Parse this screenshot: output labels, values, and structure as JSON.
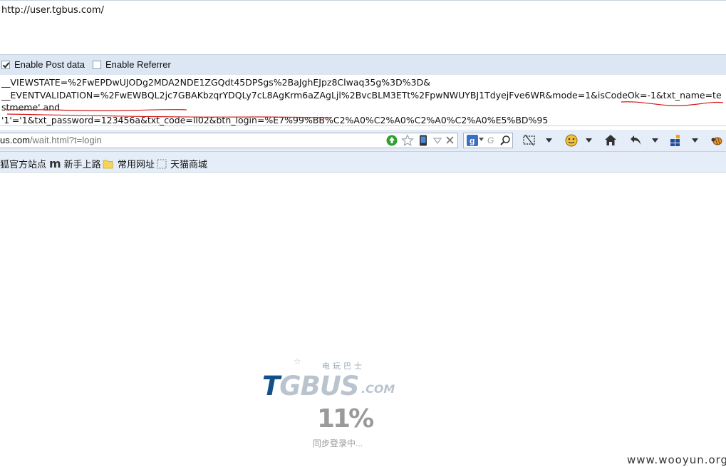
{
  "url_field": {
    "value": "http://user.tgbus.com/"
  },
  "options": {
    "enable_post_data": {
      "label": "Enable Post data",
      "checked": true
    },
    "enable_referrer": {
      "label": "Enable Referrer",
      "checked": false
    }
  },
  "post_data": {
    "line1": "__VIEWSTATE=%2FwEPDwUJODg2MDA2NDE1ZGQdt45DPSgs%2BaJghEJpz8Clwaq35g%3D%3D&",
    "line2": "__EVENTVALIDATION=%2FwEWBQL2jc7GBAKbzqrYDQLy7cL8AgKrm6aZAgLjl%2BvcBLM3ETt%2FpwNWUYBJ1TdyejFve6WR&mode=1&isCodeOk=-1&txt_name=testmeme' and",
    "line3": "'1'='1&txt_password=123456a&txt_code=ll02&btn_login=%E7%99%BB%C2%A0%C2%A0%C2%A0%C2%A0%E5%BD%95"
  },
  "address_bar": {
    "host": "us.com",
    "path": "/wait.html?t=login"
  },
  "search": {
    "placeholder": "G"
  },
  "bookmarks": [
    {
      "label": "狐官方站点",
      "icon": "firefox-icon"
    },
    {
      "label": "新手上路",
      "icon": "m-icon"
    },
    {
      "label": "常用网址",
      "icon": "folder-icon"
    },
    {
      "label": "天猫商城",
      "icon": "dashed-box-icon"
    }
  ],
  "page": {
    "logo_small": "电玩巴士",
    "logo_main": "TGBUS",
    "logo_suffix": ".COM",
    "progress": "11%",
    "progress_value": 11,
    "status": "同步登录中..."
  },
  "watermark": "www.wooyun.org",
  "colors": {
    "accent_red": "#d11a1a",
    "logo_blue": "#13508a",
    "bar_bg": "#dce7f3"
  }
}
